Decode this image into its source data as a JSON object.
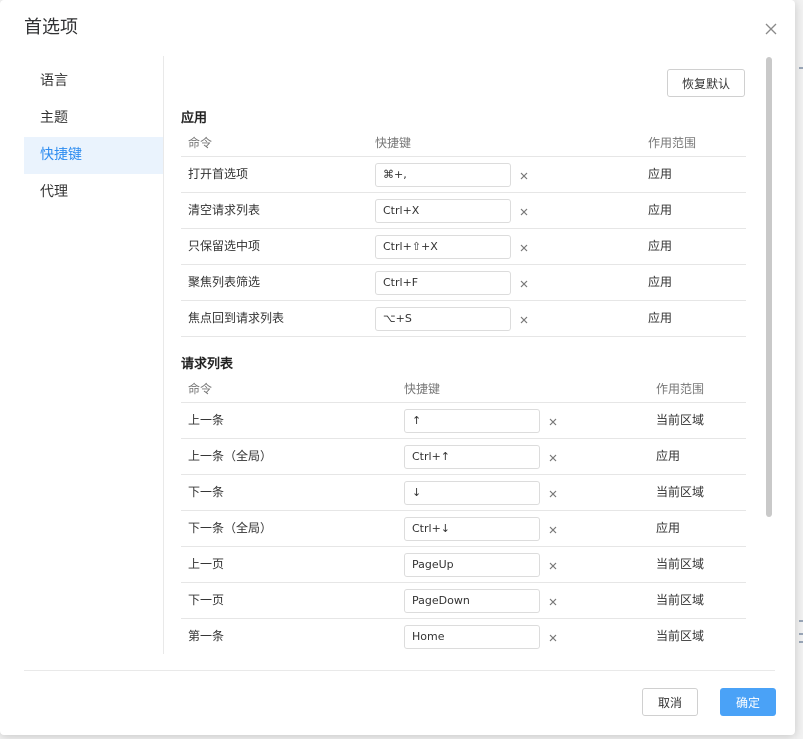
{
  "dialog": {
    "title": "首选项",
    "close_icon": "close-icon"
  },
  "sidebar": {
    "items": [
      {
        "label": "语言",
        "active": false
      },
      {
        "label": "主题",
        "active": false
      },
      {
        "label": "快捷键",
        "active": true
      },
      {
        "label": "代理",
        "active": false
      }
    ]
  },
  "content": {
    "reset_label": "恢复默认",
    "sections": [
      {
        "title": "应用",
        "columns": [
          "命令",
          "快捷键",
          "作用范围"
        ],
        "rows": [
          {
            "command": "打开首选项",
            "shortcut": "⌘+,",
            "scope": "应用"
          },
          {
            "command": "清空请求列表",
            "shortcut": "Ctrl+X",
            "scope": "应用"
          },
          {
            "command": "只保留选中项",
            "shortcut": "Ctrl+⇧+X",
            "scope": "应用"
          },
          {
            "command": "聚焦列表筛选",
            "shortcut": "Ctrl+F",
            "scope": "应用"
          },
          {
            "command": "焦点回到请求列表",
            "shortcut": "⌥+S",
            "scope": "应用"
          }
        ]
      },
      {
        "title": "请求列表",
        "columns": [
          "命令",
          "快捷键",
          "作用范围"
        ],
        "rows": [
          {
            "command": "上一条",
            "shortcut": "↑",
            "scope": "当前区域"
          },
          {
            "command": "上一条（全局）",
            "shortcut": "Ctrl+↑",
            "scope": "应用"
          },
          {
            "command": "下一条",
            "shortcut": "↓",
            "scope": "当前区域"
          },
          {
            "command": "下一条（全局）",
            "shortcut": "Ctrl+↓",
            "scope": "应用"
          },
          {
            "command": "上一页",
            "shortcut": "PageUp",
            "scope": "当前区域"
          },
          {
            "command": "下一页",
            "shortcut": "PageDown",
            "scope": "当前区域"
          },
          {
            "command": "第一条",
            "shortcut": "Home",
            "scope": "当前区域"
          }
        ]
      }
    ]
  },
  "footer": {
    "cancel_label": "取消",
    "ok_label": "确定"
  },
  "colors": {
    "accent": "#2d8cf0",
    "active_bg": "#eaf3fd",
    "primary_button": "#4aa2f7"
  }
}
